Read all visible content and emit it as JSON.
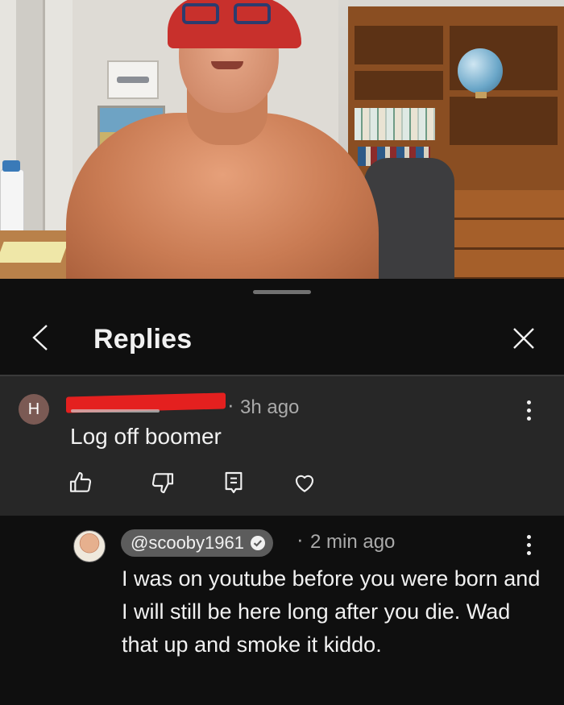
{
  "video": {
    "description_icon": "video-frame"
  },
  "header": {
    "title": "Replies",
    "back_icon": "chevron-left-icon",
    "close_icon": "close-icon"
  },
  "parent_comment": {
    "avatar_letter": "H",
    "username_redacted": true,
    "separator": "·",
    "time": "3h ago",
    "text": "Log off boomer",
    "actions": [
      "like-icon",
      "dislike-icon",
      "reply-icon",
      "heart-icon"
    ]
  },
  "reply_comment": {
    "handle": "@scooby1961",
    "verified": true,
    "separator": "·",
    "time": "2 min ago",
    "text": "I was on youtube before you were born and I will still be here long after you die.  Wad that up and smoke it kiddo."
  },
  "colors": {
    "background": "#0f0f0f",
    "parent_bg": "#272727",
    "secondary_text": "#aaaaaa",
    "handle_pill": "#5c5c5c"
  }
}
